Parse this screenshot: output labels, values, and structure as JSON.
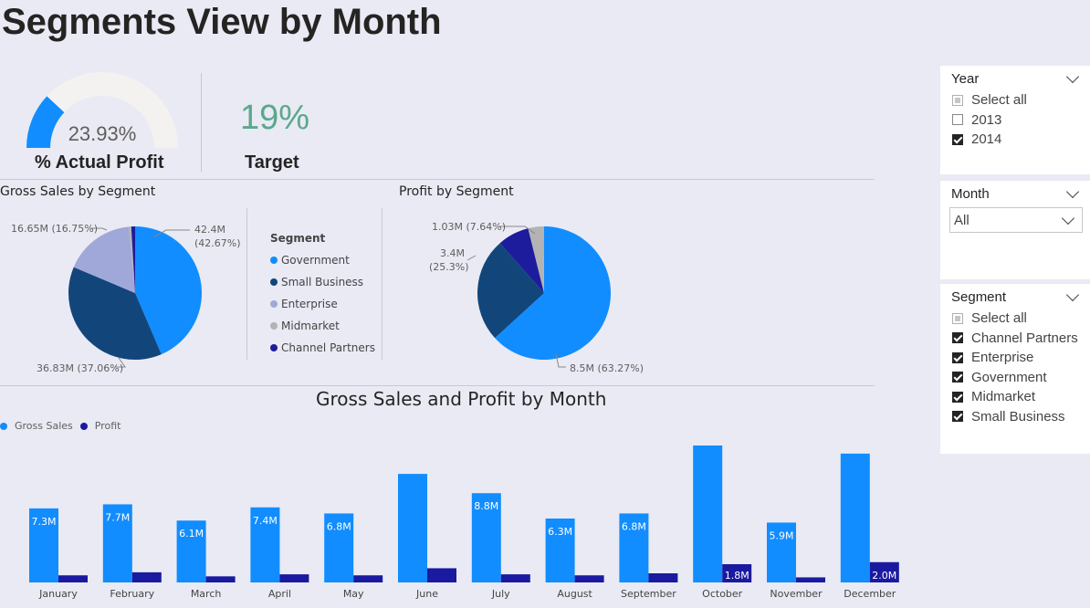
{
  "page": {
    "title": "Segments View by Month"
  },
  "kpi": {
    "gauge": {
      "value_label": "23.93%",
      "value_fraction": 0.2393,
      "label": "% Actual Profit",
      "fill_color": "#118dff",
      "track_color": "#f3f2f1"
    },
    "target": {
      "value": "19%",
      "label": "Target"
    }
  },
  "segments": [
    {
      "name": "Government",
      "color": "#118dff"
    },
    {
      "name": "Small Business",
      "color": "#12467b"
    },
    {
      "name": "Enterprise",
      "color": "#a0a7d9"
    },
    {
      "name": "Midmarket",
      "color": "#b3b3b3"
    },
    {
      "name": "Channel Partners",
      "color": "#1c1c9c"
    }
  ],
  "legend": {
    "title": "Segment"
  },
  "bar_legend": {
    "gross": "Gross Sales",
    "profit": "Profit"
  },
  "slicers": {
    "year": {
      "title": "Year",
      "items": [
        {
          "label": "Select all",
          "state": "partial"
        },
        {
          "label": "2013",
          "state": "unchecked"
        },
        {
          "label": "2014",
          "state": "checked"
        }
      ]
    },
    "month": {
      "title": "Month",
      "value": "All"
    },
    "segment": {
      "title": "Segment",
      "items": [
        {
          "label": "Select all",
          "state": "partial"
        },
        {
          "label": "Channel Partners",
          "state": "checked"
        },
        {
          "label": "Enterprise",
          "state": "checked"
        },
        {
          "label": "Government",
          "state": "checked"
        },
        {
          "label": "Midmarket",
          "state": "checked"
        },
        {
          "label": "Small Business",
          "state": "checked"
        }
      ]
    }
  },
  "chart_data": [
    {
      "type": "pie",
      "title": "Gross Sales by Segment",
      "categories": [
        "Government",
        "Small Business",
        "Enterprise",
        "Midmarket",
        "Channel Partners"
      ],
      "values": [
        42.4,
        36.83,
        16.65,
        0.6,
        0.9
      ],
      "unit": "M",
      "data_labels": [
        {
          "category": "Government",
          "text": "42.4M",
          "text2": "(42.67%)"
        },
        {
          "category": "Small Business",
          "text": "36.83M (37.06%)",
          "text2": ""
        },
        {
          "category": "Enterprise",
          "text": "16.65M (16.75%)",
          "text2": ""
        }
      ]
    },
    {
      "type": "pie",
      "title": "Profit by Segment",
      "categories": [
        "Government",
        "Small Business",
        "Channel Partners",
        "Midmarket",
        "Enterprise"
      ],
      "values": [
        8.5,
        3.4,
        1.03,
        0.5,
        0.02
      ],
      "unit": "M",
      "data_labels": [
        {
          "category": "Government",
          "text": "8.5M (63.27%)",
          "text2": ""
        },
        {
          "category": "Small Business",
          "text": "3.4M",
          "text2": "(25.3%)"
        },
        {
          "category": "Channel Partners",
          "text": "1.03M (7.64%)",
          "text2": ""
        }
      ]
    },
    {
      "type": "bar",
      "title": "Gross Sales and Profit by Month",
      "categories": [
        "January",
        "February",
        "March",
        "April",
        "May",
        "June",
        "July",
        "August",
        "September",
        "October",
        "November",
        "December"
      ],
      "series": [
        {
          "name": "Gross Sales",
          "color": "#118dff",
          "values": [
            7.3,
            7.7,
            6.1,
            7.4,
            6.8,
            10.7,
            8.8,
            6.3,
            6.8,
            13.5,
            5.9,
            12.7
          ],
          "labels": [
            "7.3M",
            "7.7M",
            "6.1M",
            "7.4M",
            "6.8M",
            "",
            "8.8M",
            "6.3M",
            "6.8M",
            "",
            "5.9M",
            ""
          ]
        },
        {
          "name": "Profit",
          "color": "#1a1aa0",
          "values": [
            0.7,
            1.0,
            0.6,
            0.8,
            0.7,
            1.4,
            0.8,
            0.7,
            0.9,
            1.8,
            0.5,
            2.0
          ],
          "labels": [
            "",
            "",
            "",
            "",
            "",
            "",
            "",
            "",
            "",
            "1.8M",
            "",
            "2.0M"
          ]
        }
      ],
      "ylim": [
        0,
        14
      ]
    }
  ]
}
